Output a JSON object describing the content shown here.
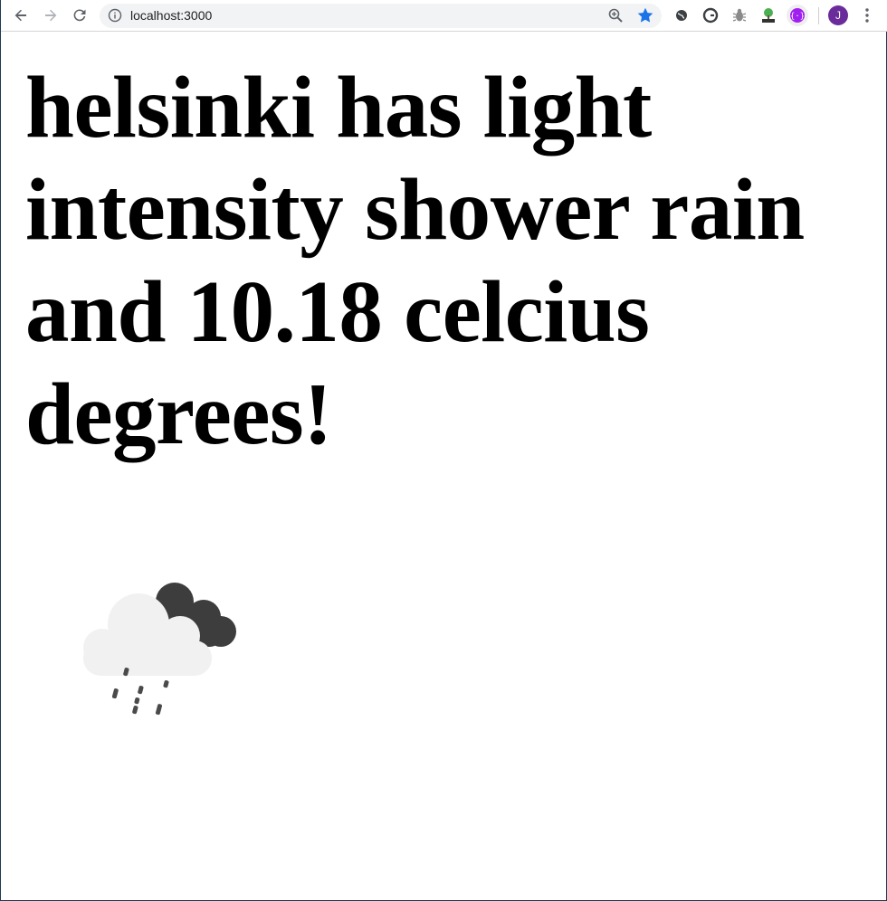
{
  "browser": {
    "url": "localhost:3000",
    "profile_initial": "J",
    "accent_star_color": "#1a73e8",
    "profile_color": "#6a2c9b"
  },
  "page": {
    "headline": "helsinki has light intensity shower rain and 10.18 celcius degrees!",
    "weather_icon": "light-intensity-shower-rain-icon"
  }
}
